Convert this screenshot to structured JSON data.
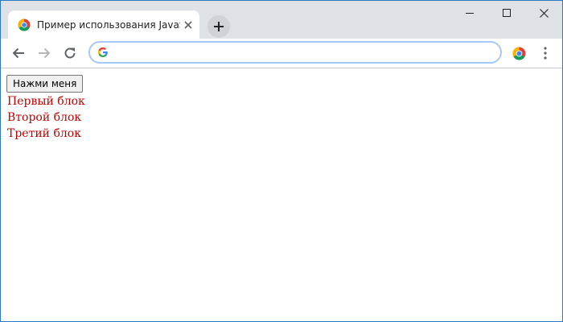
{
  "browser": {
    "tab": {
      "title": "Пример использования JavaScr",
      "favicon": "chrome-favicon-icon",
      "close_icon": "close-icon"
    },
    "new_tab_icon": "plus-icon",
    "window_controls": {
      "minimize_icon": "minimize-icon",
      "maximize_icon": "maximize-icon",
      "close_icon": "window-close-icon"
    },
    "toolbar": {
      "back_icon": "arrow-left-icon",
      "forward_icon": "arrow-right-icon",
      "reload_icon": "reload-icon",
      "address": {
        "value": "",
        "placeholder": "",
        "search_engine_icon": "google-g-icon"
      },
      "extension_icon": "chrome-extension-icon",
      "menu_icon": "more-vertical-icon"
    }
  },
  "page": {
    "button_label": "Нажми меня",
    "blocks": [
      {
        "text": "Первый блок"
      },
      {
        "text": "Второй блок"
      },
      {
        "text": "Третий блок"
      }
    ],
    "block_color": "#c00000"
  },
  "colors": {
    "window_border": "#2b78c5",
    "tabstrip": "#dee1e6",
    "omnibox_border": "#a8c7fa"
  }
}
